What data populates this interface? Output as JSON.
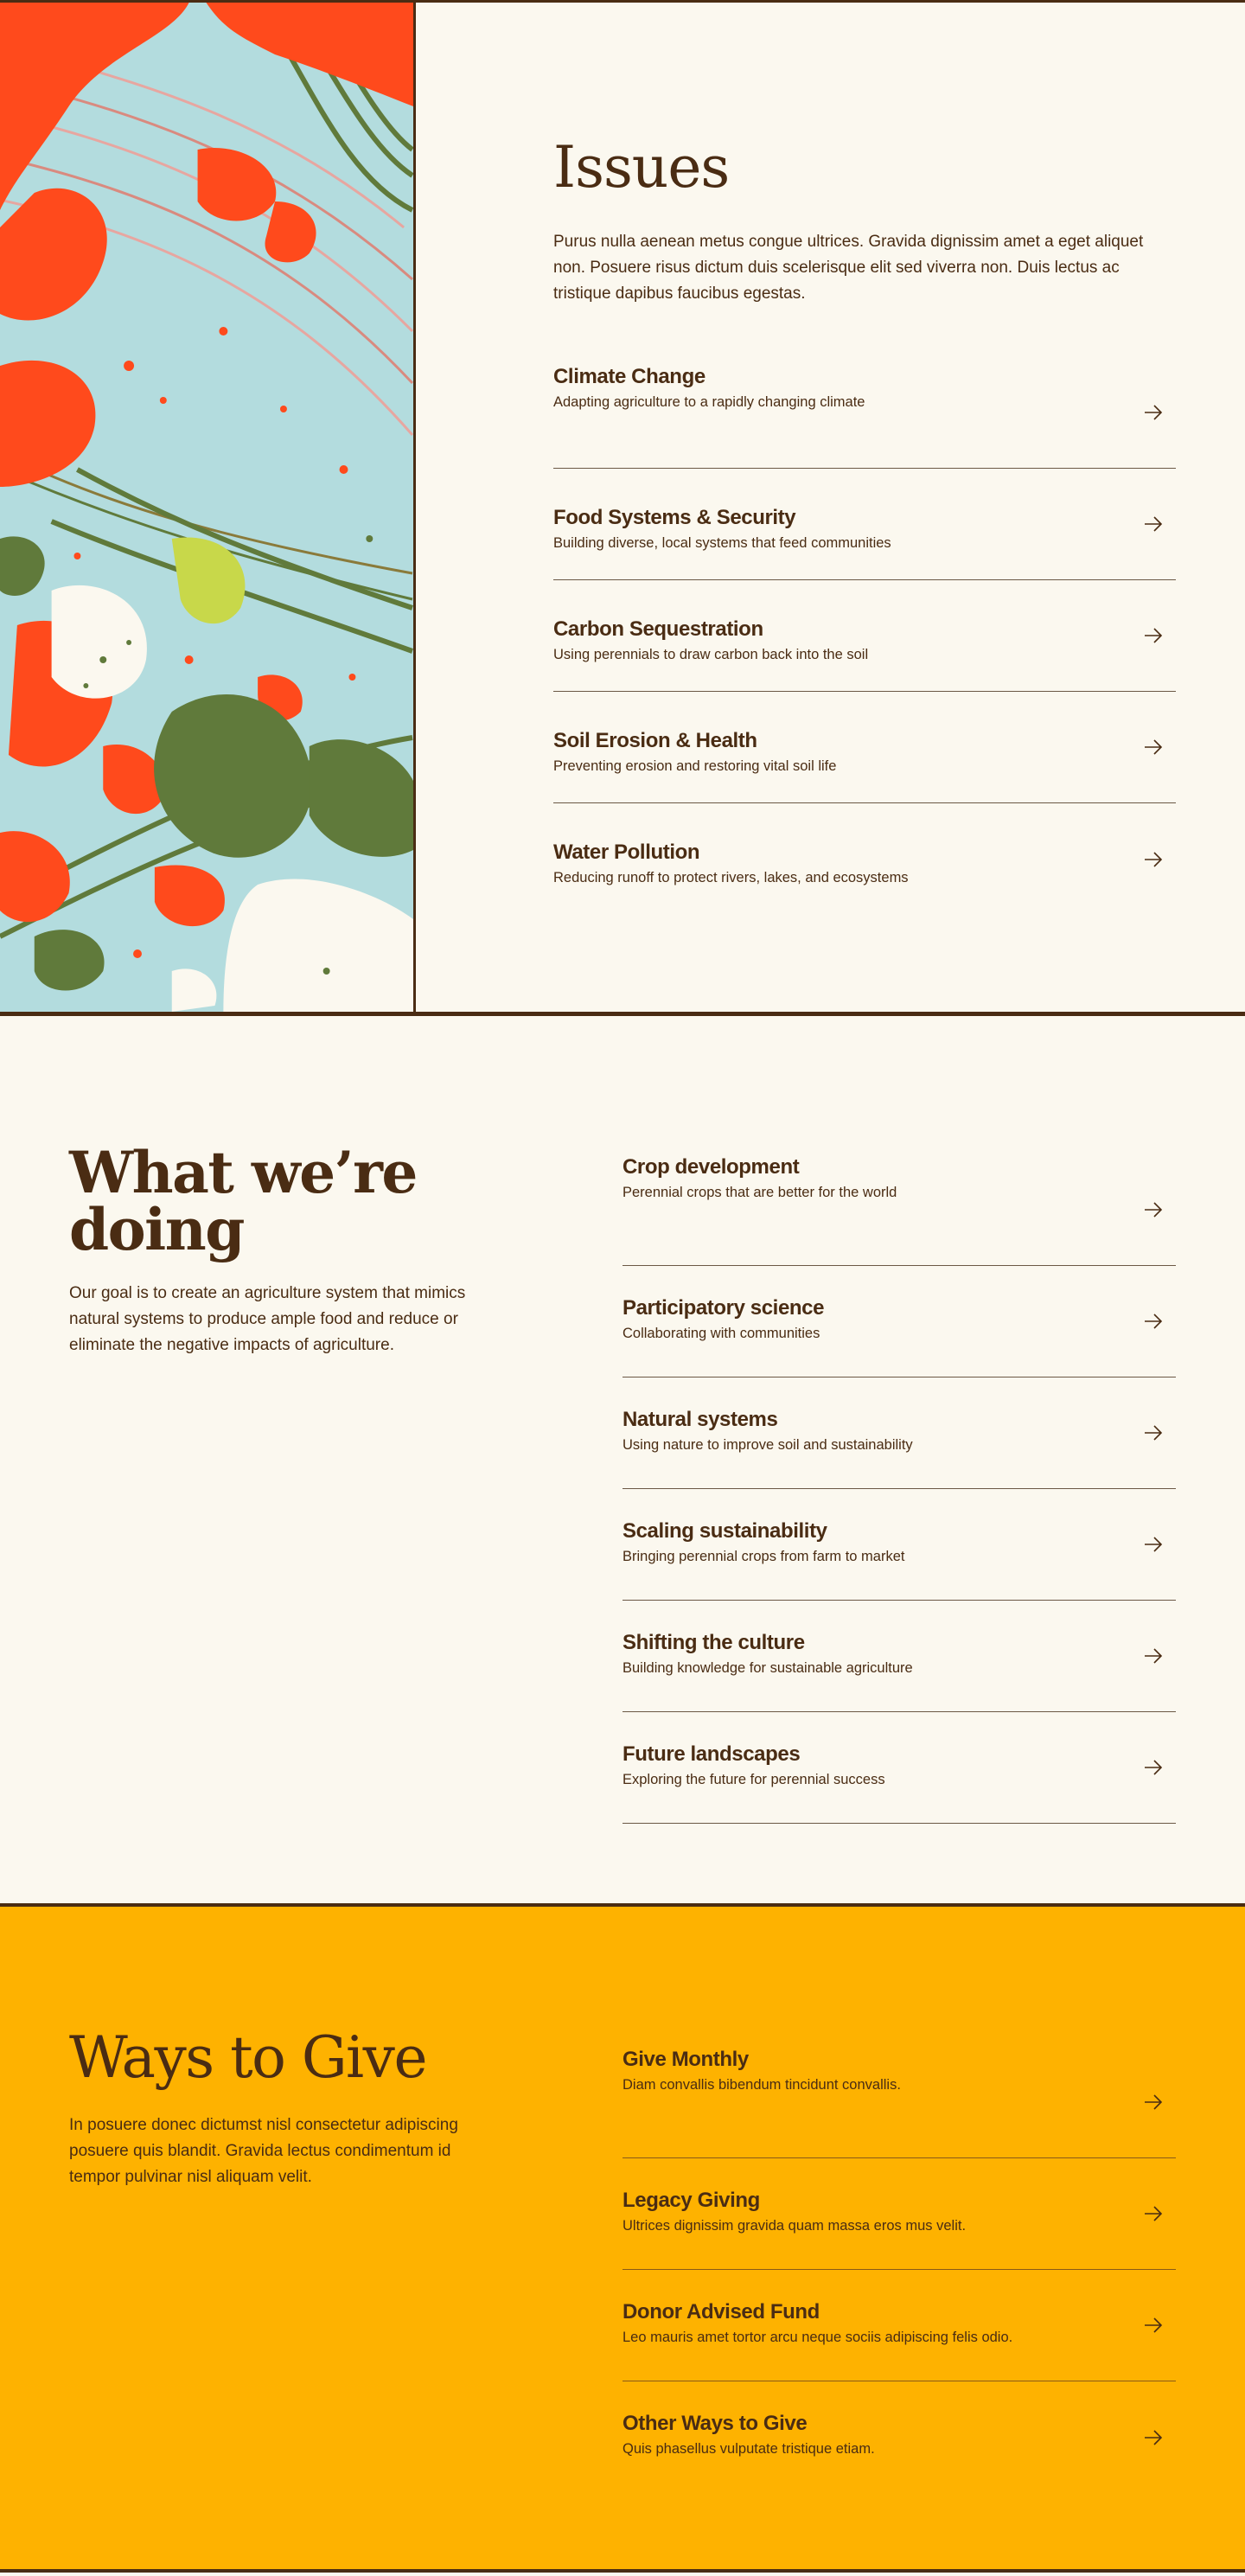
{
  "colors": {
    "cream": "#fbf8ef",
    "brown": "#4a2c13",
    "gold": "#feb200",
    "art_red": "#ff4a1c",
    "art_blue": "#b3dcde",
    "art_green": "#607a3b"
  },
  "issues": {
    "heading": "Issues",
    "intro": "Purus nulla aenean metus congue ultrices. Gravida dignissim amet a eget aliquet non. Posuere risus dictum duis scelerisque elit sed viverra non. Duis lectus ac tristique dapibus faucibus egestas.",
    "items": [
      {
        "title": "Climate Change",
        "subtitle": "Adapting agriculture to a rapidly changing climate"
      },
      {
        "title": "Food Systems & Security",
        "subtitle": "Building diverse, local systems that feed communities"
      },
      {
        "title": "Carbon Sequestration",
        "subtitle": "Using perennials to draw carbon back into the soil"
      },
      {
        "title": "Soil Erosion & Health",
        "subtitle": "Preventing erosion and restoring vital soil life"
      },
      {
        "title": "Water Pollution",
        "subtitle": "Reducing runoff to protect rivers, lakes, and ecosystems"
      }
    ]
  },
  "doing": {
    "heading": "What we’re doing",
    "paragraph": "Our goal is to create an agriculture system that mimics natural systems to produce ample food and reduce or eliminate the negative impacts of agriculture.",
    "items": [
      {
        "title": "Crop development",
        "subtitle": "Perennial crops that are better for the world"
      },
      {
        "title": "Participatory science",
        "subtitle": "Collaborating with communities"
      },
      {
        "title": "Natural systems",
        "subtitle": "Using nature to improve soil and sustainability"
      },
      {
        "title": "Scaling sustainability",
        "subtitle": "Bringing perennial crops from farm to market"
      },
      {
        "title": "Shifting the culture",
        "subtitle": "Building knowledge for sustainable agriculture"
      },
      {
        "title": "Future landscapes",
        "subtitle": "Exploring the future for perennial success"
      }
    ]
  },
  "give": {
    "heading": "Ways to Give",
    "paragraph": "In posuere donec dictumst nisl consectetur adipiscing posuere quis blandit. Gravida lectus condimentum id tempor pulvinar nisl aliquam velit.",
    "items": [
      {
        "title": "Give Monthly",
        "subtitle": "Diam convallis bibendum tincidunt convallis."
      },
      {
        "title": "Legacy Giving",
        "subtitle": "Ultrices dignissim gravida quam massa eros mus velit."
      },
      {
        "title": "Donor Advised Fund",
        "subtitle": "Leo mauris amet tortor arcu neque sociis adipiscing felis odio."
      },
      {
        "title": "Other Ways to Give",
        "subtitle": "Quis phasellus vulputate tristique etiam."
      }
    ]
  },
  "icons": {
    "row_arrow": "arrow-right-icon",
    "artwork": "abstract-landscape-artwork"
  }
}
